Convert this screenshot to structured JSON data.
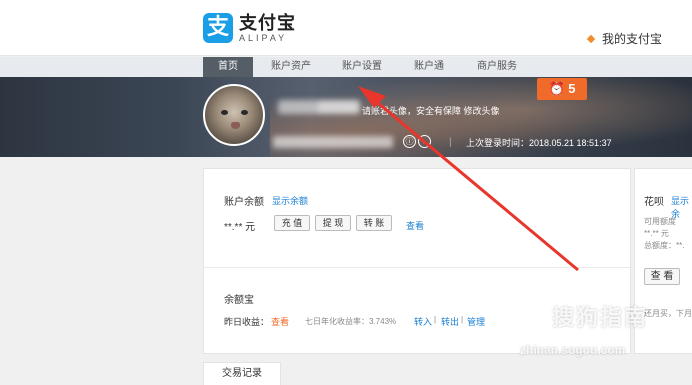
{
  "header": {
    "logo_mark": "支",
    "logo_cn": "支付宝",
    "logo_en": "ALIPAY",
    "my_alipay": "我的支付宝"
  },
  "nav": {
    "items": [
      "首页",
      "账户资产",
      "账户设置",
      "账户通",
      "商户服务"
    ],
    "active_index": 0
  },
  "profile": {
    "notice": "请账君头像，安全有保障 修改头像",
    "last_login": "上次登录时间：2018.05.21 18:51:37",
    "message_count": "5",
    "icons": [
      "id-card-icon",
      "info-icon"
    ]
  },
  "balance": {
    "label": "账户余额",
    "show_link": "显示余额",
    "amount": "**.** 元",
    "buttons": [
      "充 值",
      "提 现",
      "转 账"
    ],
    "view_link": "查看"
  },
  "yuebao": {
    "label": "余额宝",
    "yesterday_label": "昨日收益：",
    "yesterday_value": "查看",
    "rate": "七日年化收益率：3.743%",
    "actions": [
      "转入",
      "转出",
      "管理"
    ]
  },
  "huabei": {
    "label": "花呗",
    "show_link": "显示余",
    "available": "可用额度",
    "available_value": "**.** 元",
    "total": "总额度：**.",
    "view_button": "查 看",
    "footer": "还月买，下月"
  },
  "tabs": {
    "transactions": "交易记录"
  },
  "watermark": {
    "text": "搜狗指南",
    "url": "zhinan.sogou.com"
  },
  "colors": {
    "accent": "#1a7fd4",
    "orange": "#f06b2a",
    "arrow": "#e8362c"
  }
}
